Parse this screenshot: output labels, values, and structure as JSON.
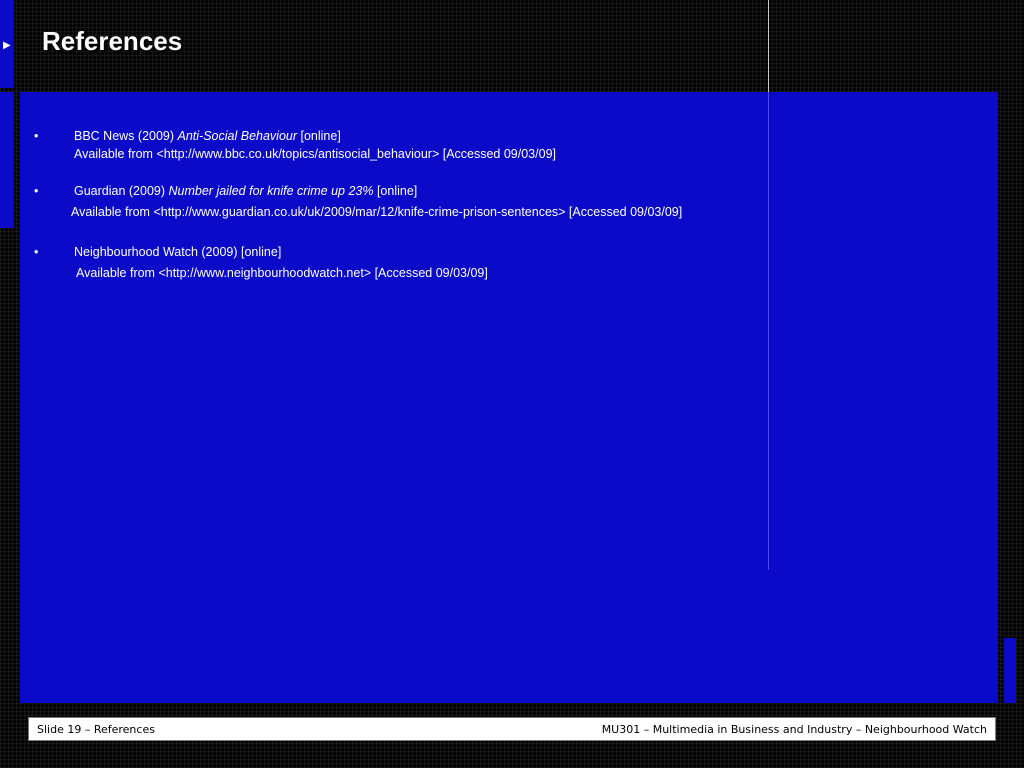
{
  "slide": {
    "title": "References",
    "nav_arrow": "▶"
  },
  "references": [
    {
      "bullet": "•",
      "prefix": "BBC News (2009) ",
      "italic_title": "Anti-Social Behaviour",
      "suffix": " [online]",
      "available": "Available from <http://www.bbc.co.uk/topics/antisocial_behaviour> [Accessed 09/03/09]"
    },
    {
      "bullet": "•",
      "prefix": "Guardian (2009) ",
      "italic_title": "Number jailed for knife crime up 23%",
      "suffix": " [online]",
      "available": "Available from <http://www.guardian.co.uk/uk/2009/mar/12/knife-crime-prison-sentences> [Accessed 09/03/09]"
    },
    {
      "bullet": "•",
      "prefix": "Neighbourhood Watch (2009) [online]",
      "italic_title": "",
      "suffix": "",
      "available": "Available from <http://www.neighbourhoodwatch.net> [Accessed 09/03/09]"
    }
  ],
  "footer": {
    "left": "Slide 19  – References",
    "right": "MU301 – Multimedia in Business and Industry – Neighbourhood Watch"
  },
  "colors": {
    "panel_blue": "#0a0ac8",
    "background": "#050505",
    "text": "#ffffff"
  }
}
